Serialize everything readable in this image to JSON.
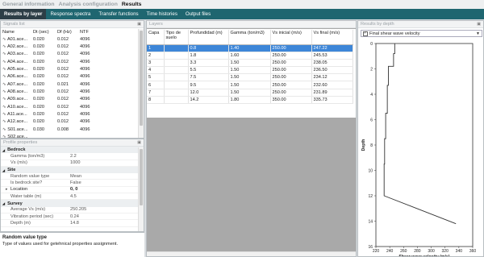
{
  "menu": {
    "items": [
      "General information",
      "Analysis configuration",
      "Results"
    ],
    "active_index": 2
  },
  "tabs": {
    "items": [
      "Results by layer",
      "Response spectra",
      "Transfer functions",
      "Time histories",
      "Output files"
    ],
    "active_index": 0
  },
  "signals": {
    "title": "Signals list",
    "columns": [
      "Name",
      "Dt (sec)",
      "Df (Hz)",
      "NTF"
    ],
    "rows": [
      [
        "A01.ace...",
        "0.020",
        "0.012",
        "4096"
      ],
      [
        "A02.ace...",
        "0.020",
        "0.012",
        "4096"
      ],
      [
        "A03.ace...",
        "0.020",
        "0.012",
        "4096"
      ],
      [
        "A04.ace...",
        "0.020",
        "0.012",
        "4096"
      ],
      [
        "A05.ace...",
        "0.020",
        "0.012",
        "4096"
      ],
      [
        "A06.ace...",
        "0.020",
        "0.012",
        "4096"
      ],
      [
        "A07.ace...",
        "0.020",
        "0.021",
        "4096"
      ],
      [
        "A08.ace...",
        "0.020",
        "0.012",
        "4096"
      ],
      [
        "A09.ace...",
        "0.020",
        "0.012",
        "4096"
      ],
      [
        "A10.ace...",
        "0.020",
        "0.012",
        "4096"
      ],
      [
        "A11.ace...",
        "0.020",
        "0.012",
        "4096"
      ],
      [
        "A12.ace...",
        "0.020",
        "0.012",
        "4096"
      ],
      [
        "S01.ace...",
        "0.030",
        "0.008",
        "4096"
      ],
      [
        "S02.ace...",
        "",
        "",
        ""
      ]
    ]
  },
  "properties": {
    "title": "Profile properties",
    "groups": [
      {
        "name": "Bedrock",
        "rows": [
          {
            "k": "Gamma (ton/m3)",
            "v": "2.2"
          },
          {
            "k": "Vs (m/s)",
            "v": "1000"
          }
        ]
      },
      {
        "name": "Site",
        "rows": [
          {
            "k": "Random value type",
            "v": "Mean"
          },
          {
            "k": "Is bedrock site?",
            "v": "False"
          },
          {
            "k": "Location",
            "v": "0, 0"
          },
          {
            "k": "Water table (m)",
            "v": "4.5"
          }
        ]
      },
      {
        "name": "Survey",
        "rows": [
          {
            "k": "Average Vs (m/s)",
            "v": "250.205"
          },
          {
            "k": "Vibration period (sec)",
            "v": "0.24"
          },
          {
            "k": "Depth (m)",
            "v": "14.8"
          }
        ]
      }
    ]
  },
  "description": {
    "title": "Random value type",
    "text": "Type of values used for getehnical properties assignment."
  },
  "layers": {
    "title": "Layers",
    "columns": [
      "Capa",
      "Tipo de suelo",
      "Profundidad (m)",
      "Gamma (ton/m3)",
      "Vs inicial (m/s)",
      "Vs final (m/s)"
    ],
    "rows": [
      [
        "1",
        "",
        "0.8",
        "1.40",
        "250.00",
        "247.22"
      ],
      [
        "2",
        "",
        "1.8",
        "1.60",
        "250.00",
        "245.53"
      ],
      [
        "3",
        "",
        "3.3",
        "1.50",
        "250.00",
        "238.05"
      ],
      [
        "4",
        "",
        "5.5",
        "1.50",
        "250.00",
        "236.50"
      ],
      [
        "5",
        "",
        "7.5",
        "1.50",
        "250.00",
        "234.12"
      ],
      [
        "6",
        "",
        "9.5",
        "1.50",
        "250.00",
        "232.60"
      ],
      [
        "7",
        "",
        "12.0",
        "1.50",
        "250.00",
        "231.89"
      ],
      [
        "8",
        "",
        "14.2",
        "1.80",
        "350.00",
        "335.73"
      ]
    ],
    "selected_index": 0
  },
  "results_by_depth": {
    "title": "Results by depth",
    "selector": {
      "value": "Final shear wave velocity",
      "checked": true
    }
  },
  "chart_data": {
    "type": "line",
    "title": "",
    "xlabel": "Shear wave velocity (m/s)",
    "ylabel": "Depth",
    "xlim": [
      220,
      360
    ],
    "ylim": [
      16,
      0
    ],
    "x_ticks": [
      "220",
      "240",
      "260",
      "280",
      "300",
      "320",
      "340",
      "360"
    ],
    "y_ticks": [
      "0",
      "2",
      "4",
      "6",
      "8",
      "10",
      "12",
      "14",
      "16"
    ],
    "series": [
      {
        "name": "",
        "color": "#333333",
        "x": [
          247.22,
          247.22,
          245.53,
          245.53,
          238.05,
          238.05,
          236.5,
          236.5,
          234.12,
          234.12,
          232.6,
          232.6,
          231.89,
          231.89,
          335.73
        ],
        "y": [
          0,
          0.8,
          0.8,
          1.8,
          1.8,
          3.3,
          3.3,
          5.5,
          5.5,
          7.5,
          7.5,
          9.5,
          9.5,
          12.0,
          14.2
        ]
      }
    ]
  }
}
